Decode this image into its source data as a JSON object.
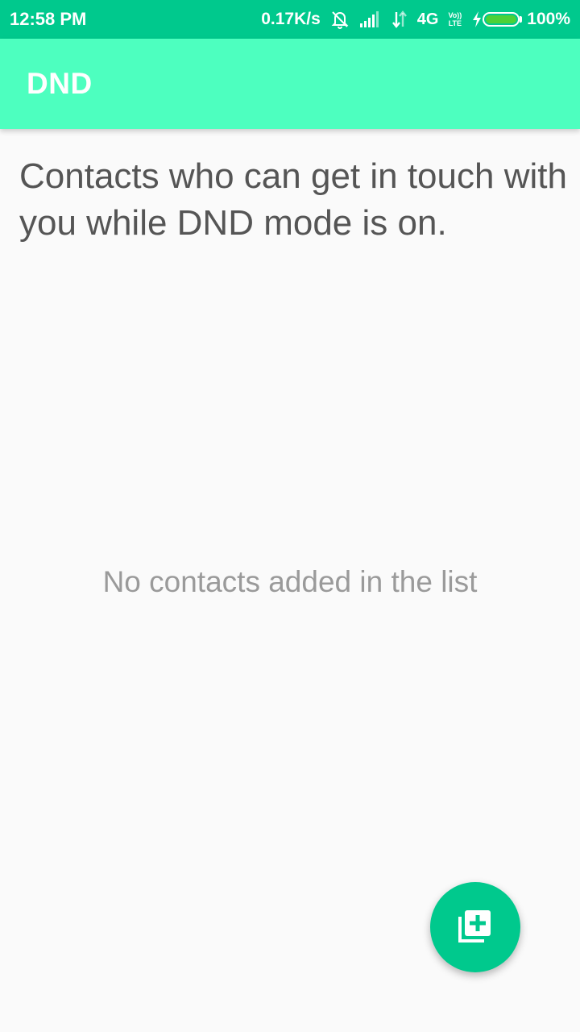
{
  "status_bar": {
    "time": "12:58 PM",
    "net_speed": "0.17K/s",
    "network_type": "4G",
    "volte_top": "Vo))",
    "volte_bottom": "LTE",
    "battery_percent": "100%",
    "battery_level": 1.0,
    "icons": [
      "alarm-off-icon",
      "signal-icon",
      "data-arrows-icon",
      "charging-bolt-icon",
      "battery-icon"
    ]
  },
  "app_bar": {
    "title": "DND"
  },
  "main": {
    "description": "Contacts who can get in touch with you while DND mode is on.",
    "empty_state": "No contacts added in the list"
  },
  "fab": {
    "icon": "add-to-list-icon"
  },
  "colors": {
    "status_bar": "#00c98d",
    "app_bar": "#4dffbf",
    "fab": "#00c98d",
    "background": "#fafafa",
    "description_text": "#555555",
    "empty_text": "#9a9a9a",
    "battery_fill": "#4cd137"
  }
}
